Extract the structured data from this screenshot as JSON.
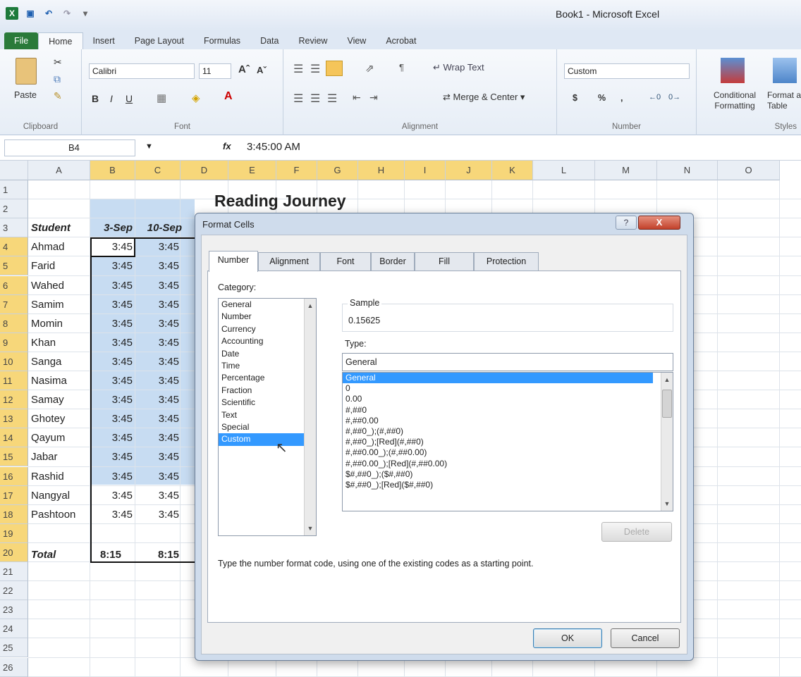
{
  "app_title": "Book1  -  Microsoft Excel",
  "tabs": [
    "File",
    "Home",
    "Insert",
    "Page Layout",
    "Formulas",
    "Data",
    "Review",
    "View",
    "Acrobat"
  ],
  "ribbon": {
    "paste_label": "Paste",
    "clipboard_label": "Clipboard",
    "font_name": "Calibri",
    "font_size": "11",
    "font_label": "Font",
    "wrap_text": "Wrap Text",
    "merge_center": "Merge & Center",
    "alignment_label": "Alignment",
    "number_format": "Custom",
    "number_label": "Number",
    "conditional_formatting": "Conditional Formatting",
    "format_as_table": "Format as Table",
    "styles_label": "Styles"
  },
  "formula_bar": {
    "cell_ref": "B4",
    "fx": "fx",
    "value": "3:45:00 AM"
  },
  "sheet": {
    "columns": [
      "A",
      "B",
      "C",
      "D",
      "E",
      "F",
      "G",
      "H",
      "I",
      "J",
      "K",
      "L",
      "M",
      "N",
      "O"
    ],
    "rows": [
      "1",
      "2",
      "3",
      "4",
      "5",
      "6",
      "7",
      "8",
      "9",
      "10",
      "11",
      "12",
      "13",
      "14",
      "15",
      "16",
      "17",
      "18",
      "19",
      "20",
      "21",
      "22",
      "23",
      "24",
      "25",
      "26"
    ],
    "title": "Reading Journey",
    "header_student": "Student",
    "header_b": "3-Sep",
    "header_c": "10-Sep",
    "students": [
      "Ahmad",
      "Farid",
      "Wahed",
      "Samim",
      "Momin",
      "Khan",
      "Sanga",
      "Nasima",
      "Samay",
      "Ghotey",
      "Qayum",
      "Jabar",
      "Rashid",
      "Nangyal",
      "Pashtoon"
    ],
    "values_b": [
      "3:45",
      "3:45",
      "3:45",
      "3:45",
      "3:45",
      "3:45",
      "3:45",
      "3:45",
      "3:45",
      "3:45",
      "3:45",
      "3:45",
      "3:45",
      "3:45",
      "3:45"
    ],
    "values_c": [
      "3:45",
      "3:45",
      "3:45",
      "3:45",
      "3:45",
      "3:45",
      "3:45",
      "3:45",
      "3:45",
      "3:45",
      "3:45",
      "3:45",
      "3:45",
      "3:45",
      "3:45"
    ],
    "total_label": "Total",
    "total_b": "8:15",
    "total_c": "8:15"
  },
  "dialog": {
    "title": "Format Cells",
    "help": "?",
    "close": "X",
    "tabs": [
      "Number",
      "Alignment",
      "Font",
      "Border",
      "Fill",
      "Protection"
    ],
    "category_label": "Category:",
    "categories": [
      "General",
      "Number",
      "Currency",
      "Accounting",
      "Date",
      "Time",
      "Percentage",
      "Fraction",
      "Scientific",
      "Text",
      "Special",
      "Custom"
    ],
    "selected_category": "Custom",
    "sample_label": "Sample",
    "sample_value": "0.15625",
    "type_label": "Type:",
    "type_value": "General",
    "types": [
      "General",
      "0",
      "0.00",
      "#,##0",
      "#,##0.00",
      "#,##0_);(#,##0)",
      "#,##0_);[Red](#,##0)",
      "#,##0.00_);(#,##0.00)",
      "#,##0.00_);[Red](#,##0.00)",
      "$#,##0_);($#,##0)",
      "$#,##0_);[Red]($#,##0)"
    ],
    "delete_label": "Delete",
    "hint": "Type the number format code, using one of the existing codes as a starting point.",
    "ok_label": "OK",
    "cancel_label": "Cancel"
  }
}
